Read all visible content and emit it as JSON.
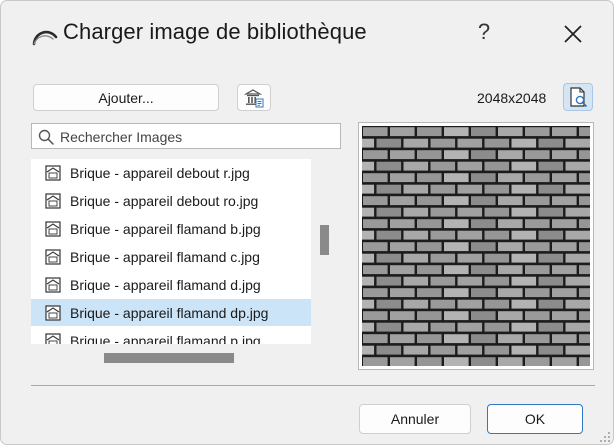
{
  "dialog": {
    "title": "Charger image de bibliothèque",
    "help_label": "?",
    "title_icon": "arc-app-icon",
    "close_icon": "close-icon"
  },
  "toolbar": {
    "add_label": "Ajouter...",
    "library_icon": "library-building-icon",
    "resolution": "2048x2048",
    "preview_icon": "document-search-icon"
  },
  "search": {
    "placeholder": "Rechercher Images",
    "value": ""
  },
  "files": {
    "items": [
      {
        "label": "Brique - appareil debout r.jpg",
        "selected": false
      },
      {
        "label": "Brique - appareil debout ro.jpg",
        "selected": false
      },
      {
        "label": "Brique - appareil flamand b.jpg",
        "selected": false
      },
      {
        "label": "Brique - appareil flamand c.jpg",
        "selected": false
      },
      {
        "label": "Brique - appareil flamand d.jpg",
        "selected": false
      },
      {
        "label": "Brique - appareil flamand dp.jpg",
        "selected": true
      },
      {
        "label": "Brique - appareil flamand p.jpg",
        "selected": false
      }
    ]
  },
  "preview": {
    "description_icon": "brick-texture-preview"
  },
  "footer": {
    "cancel_label": "Annuler",
    "ok_label": "OK"
  },
  "colors": {
    "selection": "#cce4f7",
    "ok_border": "#2f78c4",
    "preview_toggle": "#d6e5f4"
  }
}
